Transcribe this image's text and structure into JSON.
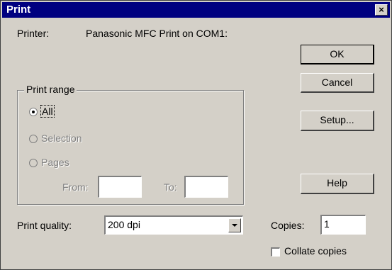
{
  "window": {
    "title": "Print",
    "close_label": "×"
  },
  "printer": {
    "label": "Printer:",
    "value": "Panasonic MFC Print on COM1:"
  },
  "buttons": {
    "ok": "OK",
    "cancel": "Cancel",
    "setup": "Setup...",
    "help": "Help"
  },
  "print_range": {
    "label": "Print range",
    "options": [
      {
        "label": "All",
        "selected": true,
        "enabled": true
      },
      {
        "label": "Selection",
        "selected": false,
        "enabled": false
      },
      {
        "label": "Pages",
        "selected": false,
        "enabled": false
      }
    ],
    "from_label": "From:",
    "from_value": "",
    "to_label": "To:",
    "to_value": ""
  },
  "quality": {
    "label": "Print quality:",
    "value": "200 dpi"
  },
  "copies": {
    "label": "Copies:",
    "value": "1"
  },
  "collate": {
    "label": "Collate copies",
    "checked": false
  }
}
